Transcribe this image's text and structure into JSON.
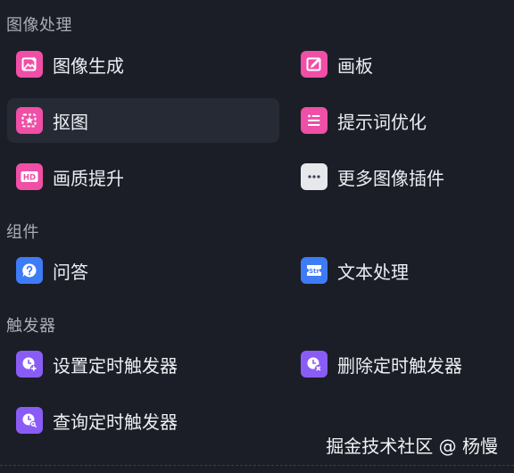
{
  "sections": {
    "image": {
      "title": "图像处理"
    },
    "components": {
      "title": "组件"
    },
    "triggers": {
      "title": "触发器"
    }
  },
  "items": {
    "image_generate": {
      "label": "图像生成",
      "icon": "image-generate-icon",
      "color": "#ef4fa6"
    },
    "canvas": {
      "label": "画板",
      "icon": "canvas-edit-icon",
      "color": "#ef4fa6"
    },
    "cutout": {
      "label": "抠图",
      "icon": "cutout-star-icon",
      "color": "#ef4fa6"
    },
    "prompt_optimize": {
      "label": "提示词优化",
      "icon": "prompt-list-icon",
      "color": "#ef4fa6"
    },
    "quality_upscale": {
      "label": "画质提升",
      "icon": "hd-icon",
      "color": "#ef4fa6"
    },
    "more_plugins": {
      "label": "更多图像插件",
      "icon": "more-dots-icon",
      "color": "#e7e8ec"
    },
    "qa": {
      "label": "问答",
      "icon": "question-icon",
      "color": "#3e7bf7"
    },
    "text_process": {
      "label": "文本处理",
      "icon": "str-icon",
      "color": "#3e7bf7"
    },
    "set_timer": {
      "label": "设置定时触发器",
      "icon": "clock-plus-icon",
      "color": "#8a5cf6"
    },
    "delete_timer": {
      "label": "删除定时触发器",
      "icon": "clock-x-icon",
      "color": "#8a5cf6"
    },
    "query_timer": {
      "label": "查询定时触发器",
      "icon": "clock-search-icon",
      "color": "#8a5cf6"
    }
  },
  "watermark": "掘金技术社区 @ 杨慢"
}
